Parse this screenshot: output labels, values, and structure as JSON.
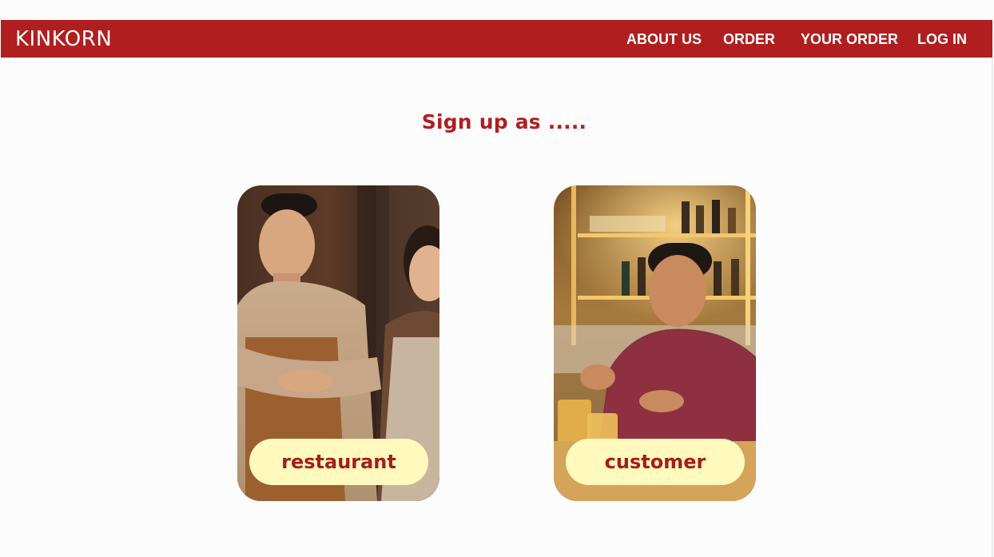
{
  "header": {
    "logo": "KINKORN",
    "nav": [
      {
        "label": "ABOUT US"
      },
      {
        "label": "ORDER"
      },
      {
        "label": "YOUR ORDER"
      },
      {
        "label": "LOG IN"
      }
    ]
  },
  "main": {
    "heading": "Sign up as .....",
    "options": [
      {
        "label": "restaurant",
        "image": "restaurant-staff-photo"
      },
      {
        "label": "customer",
        "image": "customer-photo"
      }
    ]
  },
  "colors": {
    "brand_red": "#b01e20",
    "pill_yellow": "#fff9bd",
    "background": "#fdfcfd"
  }
}
